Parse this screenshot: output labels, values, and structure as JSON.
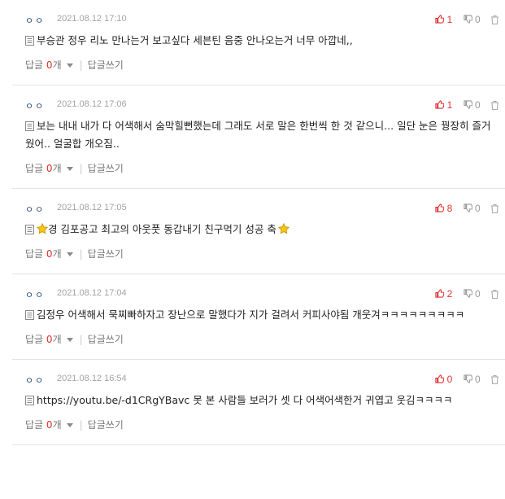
{
  "icons": {
    "comment": "document-icon",
    "like": "thumbs-up-icon",
    "dislike": "thumbs-down-icon",
    "delete": "trash-icon",
    "star": "star-icon",
    "caret": "caret-down-icon"
  },
  "colors": {
    "like": "#dd3333",
    "count": "#e0312b",
    "author": "#2b4a7a",
    "date": "#a3a3a3",
    "star": "#f5b400"
  },
  "labels": {
    "reply": "답글",
    "reply_suffix": "개",
    "write_reply": "답글쓰기"
  },
  "comments": [
    {
      "author": "ㅇㅇ",
      "date": "2021.08.12 17:10",
      "likes": "1",
      "dislikes": "0",
      "text": "부승관 정우 리노 만나는거 보고싶다 세븐틴 음중 안나오는거 너무 아깝네,,",
      "replies": "0"
    },
    {
      "author": "ㅇㅇ",
      "date": "2021.08.12 17:06",
      "likes": "1",
      "dislikes": "0",
      "text": "보는 내내 내가 다 어색해서 숨막힐뻔했는데 그래도 서로 말은 한번씩 한 것 같으니... 일단 눈은 꿩장히 즐거웠어.. 얼굴합 개오짐..",
      "replies": "0"
    },
    {
      "author": "ㅇㅇ",
      "date": "2021.08.12 17:05",
      "likes": "8",
      "dislikes": "0",
      "text_pre": "",
      "text_mid": "경 김포공고 최고의 아웃풋 동갑내기 친구먹기 성공 축",
      "text_post": "",
      "replies": "0"
    },
    {
      "author": "ㅇㅇ",
      "date": "2021.08.12 17:04",
      "likes": "2",
      "dislikes": "0",
      "text": "김정우 어색해서 묵찌빠하자고 장난으로 말했다가 지가 걸려서 커피사야됨 개웃겨ㅋㅋㅋㅋㅋㅋㅋㅋㅋ",
      "replies": "0"
    },
    {
      "author": "ㅇㅇ",
      "date": "2021.08.12 16:54",
      "likes": "0",
      "dislikes": "0",
      "text": "https://youtu.be/-d1CRgYBavc 못 본 사람들 보러가 셋 다 어색어색한거 귀엽고 웃김ㅋㅋㅋㅋ",
      "replies": "0"
    }
  ]
}
